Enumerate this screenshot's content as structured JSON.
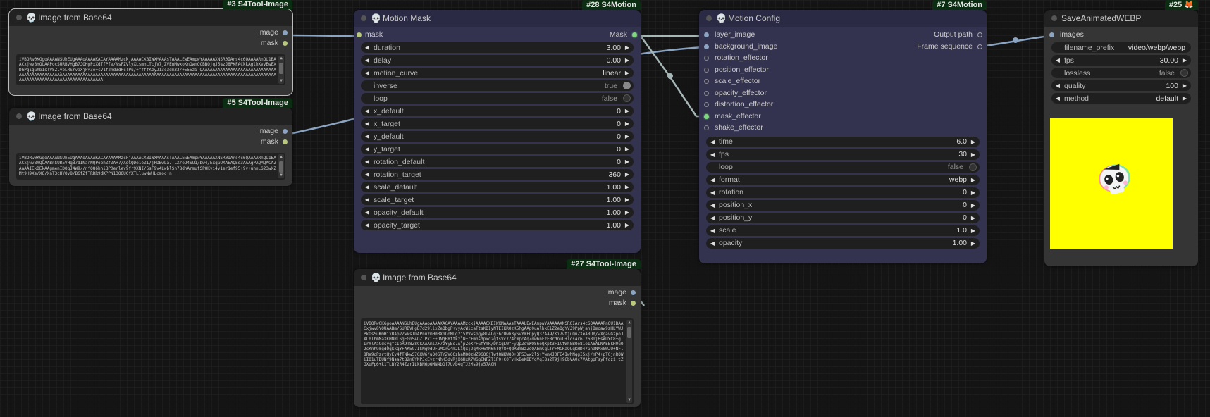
{
  "nodes": {
    "img3": {
      "badge": "#3 S4Tool-Image",
      "title": "Image from Base64",
      "outputs": [
        "image",
        "mask"
      ],
      "b64": "iVBORw0KGgoAAAANSUhEUgAAAoAAAAKACAYAAAAMzckjAAAACXBIWXMAAAsTAAALEwEAmpwYAAAAAXNSR0IArs4c6QAAAARnQU1BAACxjwv8YQUAAPocSURBVHgB7JOHgPxXdffPfe/NsFZVlyXLsmnLTcjV7jZVEnMwxoKnOwmQCBBQjqJ5%zJ8PKFACkkAglhXvVEwEXDhPgigGhb1slVSZlybLRSrvaXjPv3e+cV1f2nd3dPclPu/+ffffKzyJ13c3dm33/+555zi QAAAAAAAAAAAAAAAAAAAAAAAAAAAAAAAAAAAAAAAAAAAAAAAAAAAAAAAAAAAAAAAAAAAAAAAAAAAAAAAAAAAAAAAAAAAAAAAAAAAAAAAAAAAAAAAAAAAAAAAAAAAAAAAAAAAAAAAAAAAAAAAAAAAAAAAAAAAAAAAAAAA"
    },
    "img5": {
      "badge": "#5 S4Tool-Image",
      "title": "Image from Base64",
      "outputs": [
        "image",
        "mask"
      ],
      "b64": "iVBORw0KGgoAAAANSUhEUgAAAoAAAAKACAYAAAAMzckjAAAACXBIWXMAAAsTAAALEwEAmpwYAAAAAXNSR0IArs4c6QAAAARnQU1BAACxjwv8YQUAABnSUREVHgB7dINarNQPobhZfZA+7/XgCQDe1eZ1/jPDBwLa7TLXreO4SU1/bw4/ExqGUXAEAQEq3AAAgPAQMQACAZAaAAIEkDEkAAgmenIDOqJ4W9//nfQ86hhiBP0erlev9fr9XNI/6sF9v4LwblSn78dhArmufSPOKvi4v1er1ef95+9v+uhnLS23wXZMt9H9Xs/X6/XnT3cHYOv8/BGfZfTRRR9dKPPN13OOUCfXTLluwNWHLcmoc+n"
    },
    "img27": {
      "badge": "#27 S4Tool-Image",
      "title": "Image from Base64",
      "outputs": [
        "image",
        "mask"
      ],
      "b64": "iVBORw0KGgoAAAANSUhEUgAAAoAAAAKACAYAAAAMzckjAAAACXBIWXMAAAsTAAALEwEAmpwYAAAAAXNSR0IArs4c6QAAAARnQU1BAACxjwv8YQUAABm/SURBVHgB7d29llxZeQbgP+vyAcWicaTtsKDIyNTEIKROzK5hgAAp0uAlhkEiZ2eQgYVJ9PpWjanjBmoaw9zHLYWJPkOsSuKmHixBAp2ZwVsIDAPnu2mH03XnOoMUg2j5VVwspgy8U4Lg36cUwh3ySvYmFCpyQ3ZAA9/Ki7vtjuQuZXeA8UY/wXgavGzpoJXL0ThmMaXKHNRLSgEGn54QZJPkiE+DNgH8ffkzjN+r+mnsdpxd2gfsVc7Z4cmpcAqZdw6nFzE8rdnuU+IcsAr6Iz6Bnj6sWUYC8+gTIrYlAa9dsyqfsIeR9T8Z8CkAAAmlX+7zYyBc7AjpZeXrFGfYmR/DhXqLWfFyQpZeVWOS6eQXpt3F1ltWh8BOe81e1A6ALNAEBkH0uO2cKnh9mgdOqkkqYFAK5G7ISNg9dUFuMCrw4m2LiQxj2qMk+6fN6hTQY8+QdRBmBzZeQAbmCgLTrFMCRaOUqKHD47Gn9NMx8WJU+NFl8Ra9qPzrtHyEy4fTNkwS7GXW6/uQ06TYZV6CzhaMQOzNZ9GQGjTwt8NKWQ0+OP53ww2lS+YwmXJ0FE4IwhNqgI5xj/nP4+pT0jnRQWiIO1uTDUNf9Nsa7tB2n8YNPJcEvzrNhK3dvRjXGHxR7WGqENFZl1P0+C0TvHxBeKBDYqVqI8s2T9jH96bVA0c7VAtgpFsyFfdzi+tZGXuFp6+k1TLBY2R4ZzrILkBN6pOMN4bDf7U/b4qTJ2Ms9jv57AGM"
    },
    "motion_mask": {
      "badge": "#28 S4Motion",
      "title": "Motion Mask",
      "input": "mask",
      "output": "Mask",
      "widgets": [
        {
          "label": "duration",
          "value": "3.00",
          "kind": "num"
        },
        {
          "label": "delay",
          "value": "0.00",
          "kind": "num"
        },
        {
          "label": "motion_curve",
          "value": "linear",
          "kind": "combo"
        },
        {
          "label": "inverse",
          "value": "true",
          "kind": "toggle_on"
        },
        {
          "label": "loop",
          "value": "false",
          "kind": "toggle_off"
        },
        {
          "label": "x_default",
          "value": "0",
          "kind": "num"
        },
        {
          "label": "x_target",
          "value": "0",
          "kind": "num"
        },
        {
          "label": "y_default",
          "value": "0",
          "kind": "num"
        },
        {
          "label": "y_target",
          "value": "0",
          "kind": "num"
        },
        {
          "label": "rotation_default",
          "value": "0",
          "kind": "num"
        },
        {
          "label": "rotation_target",
          "value": "360",
          "kind": "num"
        },
        {
          "label": "scale_default",
          "value": "1.00",
          "kind": "num"
        },
        {
          "label": "scale_target",
          "value": "1.00",
          "kind": "num"
        },
        {
          "label": "opacity_default",
          "value": "1.00",
          "kind": "num"
        },
        {
          "label": "opacity_target",
          "value": "1.00",
          "kind": "num"
        }
      ]
    },
    "motion_config": {
      "badge": "#7 S4Motion",
      "title": "Motion Config",
      "inputs": [
        {
          "label": "layer_image",
          "state": "blue"
        },
        {
          "label": "background_image",
          "state": "blue"
        },
        {
          "label": "rotation_effector",
          "state": "hollow"
        },
        {
          "label": "position_effector",
          "state": "hollow"
        },
        {
          "label": "scale_effector",
          "state": "hollow"
        },
        {
          "label": "opacity_effector",
          "state": "hollow"
        },
        {
          "label": "distortion_effector",
          "state": "hollow"
        },
        {
          "label": "mask_effector",
          "state": "green"
        },
        {
          "label": "shake_effector",
          "state": "hollow"
        }
      ],
      "outputs": [
        "Output path",
        "Frame sequence"
      ],
      "widgets": [
        {
          "label": "time",
          "value": "6.0",
          "kind": "num"
        },
        {
          "label": "fps",
          "value": "30",
          "kind": "num"
        },
        {
          "label": "loop",
          "value": "false",
          "kind": "toggle_off"
        },
        {
          "label": "format",
          "value": "webp",
          "kind": "combo"
        },
        {
          "label": "rotation",
          "value": "0",
          "kind": "num"
        },
        {
          "label": "position_x",
          "value": "0",
          "kind": "num"
        },
        {
          "label": "position_y",
          "value": "0",
          "kind": "num"
        },
        {
          "label": "scale",
          "value": "1.0",
          "kind": "num"
        },
        {
          "label": "opacity",
          "value": "1.00",
          "kind": "num"
        }
      ]
    },
    "save": {
      "badge": "#25 🦊",
      "title": "SaveAnimatedWEBP",
      "input": "images",
      "widgets": [
        {
          "label": "filename_prefix",
          "value": "video/webp/webp",
          "kind": "text"
        },
        {
          "label": "fps",
          "value": "30.00",
          "kind": "num"
        },
        {
          "label": "lossless",
          "value": "false",
          "kind": "toggle_off"
        },
        {
          "label": "quality",
          "value": "100",
          "kind": "num"
        },
        {
          "label": "method",
          "value": "default",
          "kind": "combo"
        }
      ],
      "preview_color": "#ffff00"
    }
  }
}
